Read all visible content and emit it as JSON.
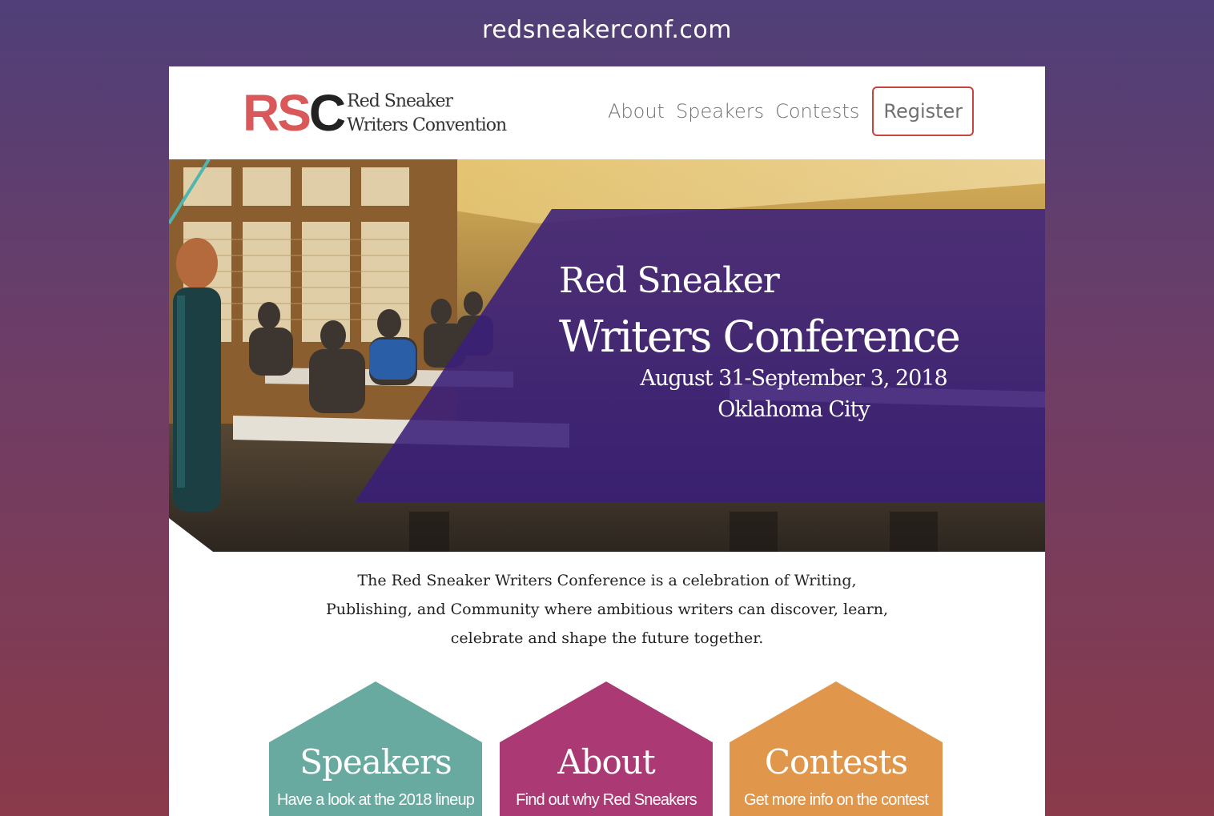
{
  "caption": {
    "url": "redsneakerconf.com"
  },
  "header": {
    "logo_mark_rs": "RS",
    "logo_mark_c": "C",
    "logo_line1": "Red Sneaker",
    "logo_line2": "Writers Convention",
    "nav": {
      "about": "About",
      "speakers": "Speakers",
      "contests": "Contests",
      "register": "Register"
    }
  },
  "hero": {
    "title": "Red Sneaker",
    "subtitle": "Writers Conference",
    "dates": "August 31-September 3, 2018",
    "city": "Oklahoma City"
  },
  "intro": {
    "line1": "The Red Sneaker Writers Conference is a celebration of Writing,",
    "line2": "Publishing, and Community where ambitious writers can discover, learn,",
    "line3": "celebrate and shape the future together."
  },
  "cards": [
    {
      "title": "Speakers",
      "description": "Have a look at the 2018 lineup",
      "color": "#69aaa0"
    },
    {
      "title": "About",
      "description": "Find out why Red Sneakers",
      "color": "#ab3a74"
    },
    {
      "title": "Contests",
      "description": "Get more info on the contest",
      "color": "#e0974c"
    }
  ],
  "colors": {
    "accent_red": "#c9443f",
    "hero_overlay": "#3a1f7a",
    "logo_red": "#d9585a"
  }
}
